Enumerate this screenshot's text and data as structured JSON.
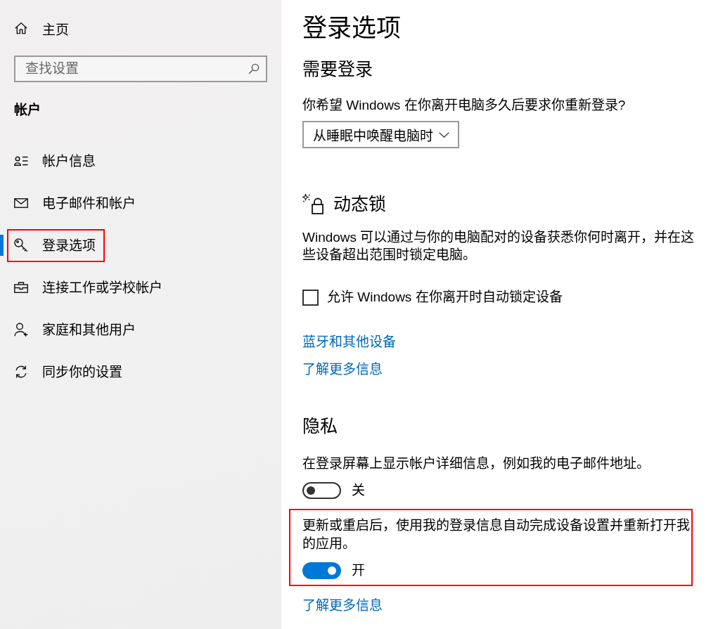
{
  "sidebar": {
    "home": {
      "label": "主页"
    },
    "search": {
      "placeholder": "查找设置"
    },
    "section_title": "帐户",
    "items": [
      {
        "label": "帐户信息",
        "selected": false,
        "highlighted": false
      },
      {
        "label": "电子邮件和帐户",
        "selected": false,
        "highlighted": false
      },
      {
        "label": "登录选项",
        "selected": true,
        "highlighted": true
      },
      {
        "label": "连接工作或学校帐户",
        "selected": false,
        "highlighted": false
      },
      {
        "label": "家庭和其他用户",
        "selected": false,
        "highlighted": false
      },
      {
        "label": "同步你的设置",
        "selected": false,
        "highlighted": false
      }
    ]
  },
  "main": {
    "title": "登录选项",
    "require_sign_in": {
      "heading": "需要登录",
      "question": "你希望 Windows 在你离开电脑多久后要求你重新登录?",
      "dropdown": {
        "value": "从睡眠中唤醒电脑时"
      }
    },
    "dynamic_lock": {
      "heading": "动态锁",
      "description": "Windows 可以通过与你的电脑配对的设备获悉你何时离开，并在这些设备超出范围时锁定电脑。",
      "checkbox": {
        "label": "允许 Windows 在你离开时自动锁定设备",
        "checked": false
      },
      "links": [
        "蓝牙和其他设备",
        "了解更多信息"
      ]
    },
    "privacy": {
      "heading": "隐私",
      "settings": [
        {
          "description": "在登录屏幕上显示帐户详细信息，例如我的电子邮件地址。",
          "on": false,
          "state_label": "关",
          "highlighted": false
        },
        {
          "description": "更新或重启后，使用我的登录信息自动完成设备设置并重新打开我的应用。",
          "on": true,
          "state_label": "开",
          "highlighted": true
        }
      ],
      "link": "了解更多信息"
    }
  }
}
